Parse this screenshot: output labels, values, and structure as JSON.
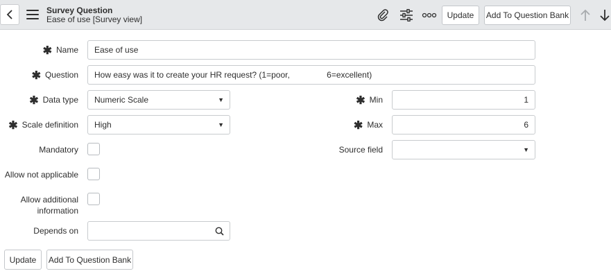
{
  "header": {
    "title": "Survey Question",
    "subtitle": "Ease of use [Survey view]",
    "update_label": "Update",
    "add_to_bank_label": "Add To Question Bank",
    "icons": [
      "back-icon",
      "hamburger-menu-icon",
      "paperclip-icon",
      "settings-sliders-icon",
      "more-options-icon",
      "arrow-up-icon",
      "arrow-down-icon"
    ]
  },
  "form": {
    "name": {
      "label": "Name",
      "value": "Ease of use"
    },
    "question": {
      "label": "Question",
      "value": "How easy was it to create your HR request? (1=poor,                6=excellent)"
    },
    "data_type": {
      "label": "Data type",
      "value": "Numeric Scale"
    },
    "scale_definition": {
      "label": "Scale definition",
      "value": "High"
    },
    "min": {
      "label": "Min",
      "value": "1"
    },
    "max": {
      "label": "Max",
      "value": "6"
    },
    "mandatory": {
      "label": "Mandatory",
      "checked": false
    },
    "source_field": {
      "label": "Source field",
      "value": ""
    },
    "allow_not_applicable": {
      "label": "Allow not applicable",
      "checked": false
    },
    "allow_additional_information": {
      "label_line1": "Allow additional",
      "label_line2": "information",
      "checked": false
    },
    "depends_on": {
      "label": "Depends on",
      "value": ""
    }
  },
  "footer": {
    "update_label": "Update",
    "add_to_bank_label": "Add To Question Bank"
  }
}
